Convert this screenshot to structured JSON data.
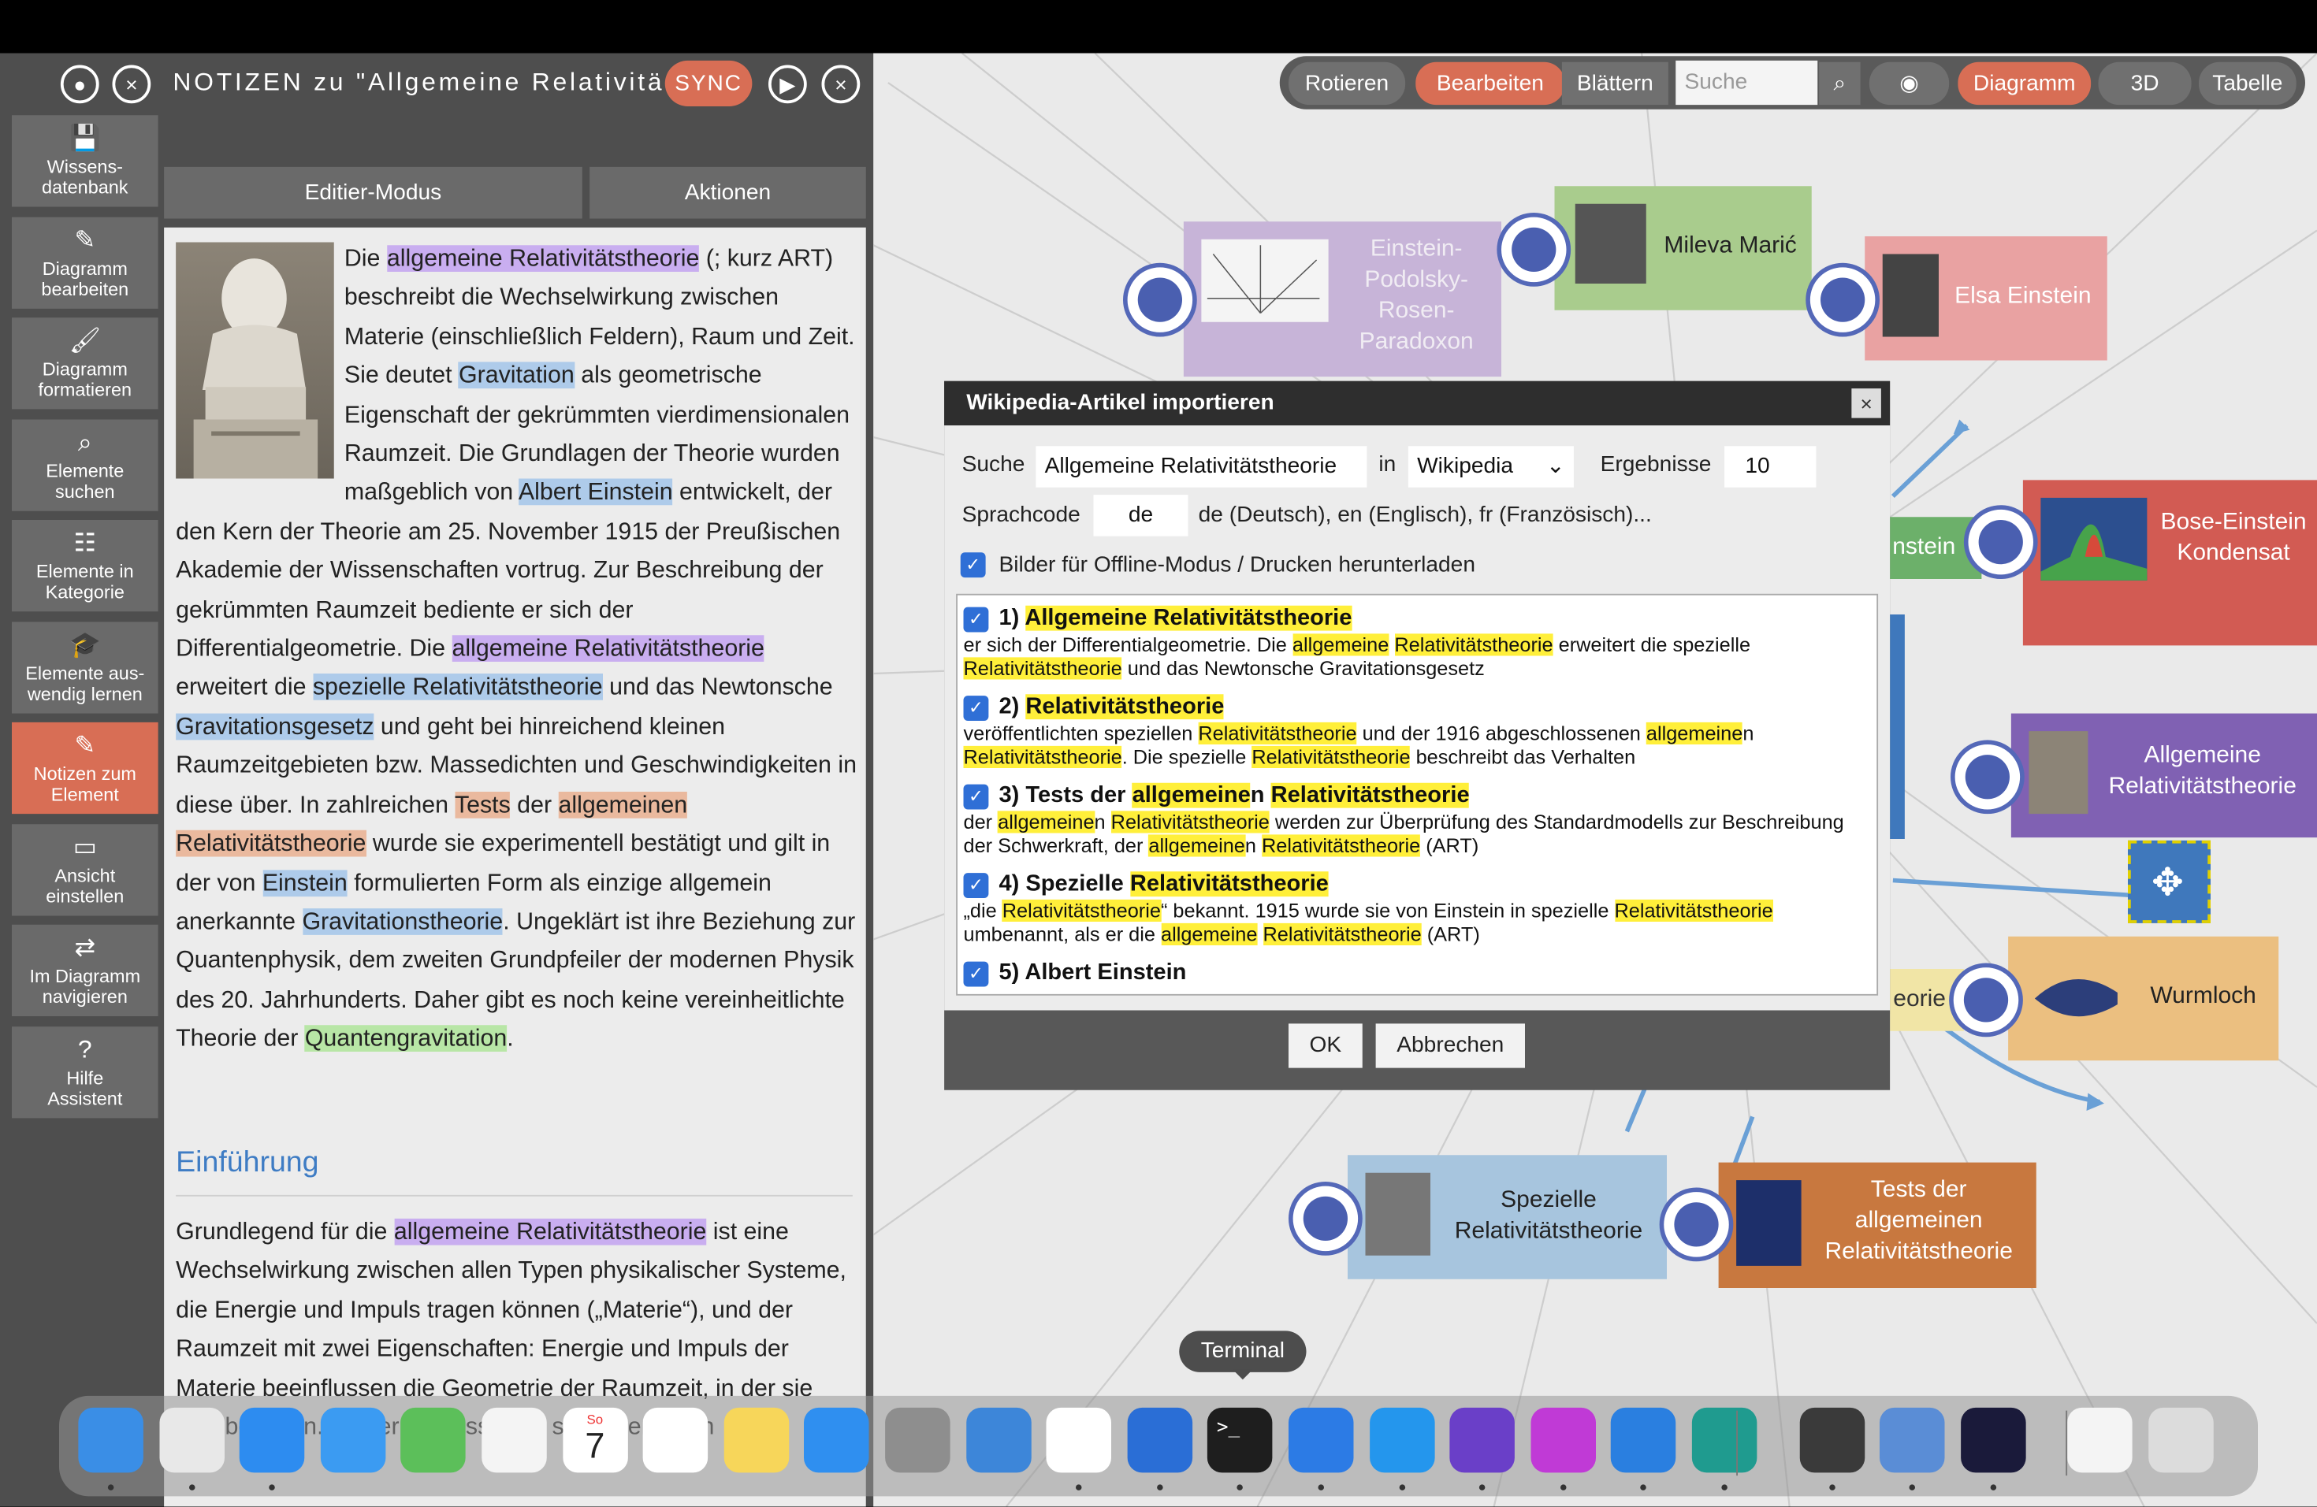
{
  "notes": {
    "title": "NOTIZEN zu \"Allgemeine Relativitä",
    "sync_label": "SYNC",
    "tabs": [
      "Editier-Modus",
      "Aktionen"
    ],
    "sidebar": [
      {
        "label": "Wissens-\ndatenbank",
        "icon": "save-icon"
      },
      {
        "label": "Diagramm\nbearbeiten",
        "icon": "pencil-icon"
      },
      {
        "label": "Diagramm\nformatieren",
        "icon": "brush-icon"
      },
      {
        "label": "Elemente\nsuchen",
        "icon": "search-icon"
      },
      {
        "label": "Elemente in\nKategorie",
        "icon": "category-icon"
      },
      {
        "label": "Elemente aus-\nwendig lernen",
        "icon": "graduation-icon"
      },
      {
        "label": "Notizen zum\nElement",
        "icon": "notes-icon"
      },
      {
        "label": "Ansicht\neinstellen",
        "icon": "monitor-icon"
      },
      {
        "label": "Im Diagramm\nnavigieren",
        "icon": "swap-icon"
      },
      {
        "label": "Hilfe\nAssistent",
        "icon": "help-icon"
      }
    ],
    "para1": [
      {
        "t": "Die "
      },
      {
        "t": "allgemeine Relativitätstheorie",
        "h": "p"
      },
      {
        "t": " (; kurz ART) beschreibt die Wechselwirkung zwischen Materie (einschließlich Feldern), Raum und Zeit. Sie deutet "
      },
      {
        "t": "Gravitation",
        "h": "b"
      },
      {
        "t": " als geometrische Eigenschaft der gekrümmten vierdimensionalen Raumzeit. Die Grundlagen der Theorie wurden maßgeblich von "
      },
      {
        "t": "Albert Einstein",
        "h": "b"
      },
      {
        "t": " entwickelt, der den Kern der Theorie am 25. November 1915 der Preußischen Akademie der Wissenschaften vortrug. Zur Beschreibung der gekrümmten Raumzeit bediente er sich der Differentialgeometrie. Die "
      },
      {
        "t": "allgemeine Relativitätstheorie",
        "h": "p"
      },
      {
        "t": " erweitert die "
      },
      {
        "t": "spezielle Relativitätstheorie",
        "h": "b"
      },
      {
        "t": " und das Newtonsche "
      },
      {
        "t": "Gravitationsgesetz",
        "h": "b"
      },
      {
        "t": " und geht bei hinreichend kleinen Raumzeitgebieten bzw. Massedichten und Geschwindigkeiten in diese über. In zahlreichen "
      },
      {
        "t": "Tests",
        "h": "o"
      },
      {
        "t": " der "
      },
      {
        "t": "allgemeinen Relativitätstheorie",
        "h": "o"
      },
      {
        "t": " wurde sie experimentell bestätigt und gilt in der von "
      },
      {
        "t": "Einstein",
        "h": "b"
      },
      {
        "t": " formulierten Form als einzige allgemein anerkannte "
      },
      {
        "t": "Gravitationstheorie",
        "h": "b"
      },
      {
        "t": ". Ungeklärt ist ihre Beziehung zur Quantenphysik, dem zweiten Grundpfeiler der modernen Physik des 20. Jahrhunderts. Daher gibt es noch keine vereinheitlichte Theorie der "
      },
      {
        "t": "Quantengravitation",
        "h": "g"
      },
      {
        "t": "."
      }
    ],
    "section_heading": "Einführung",
    "para2": [
      {
        "t": "Grundlegend für die "
      },
      {
        "t": "allgemeine Relativitätstheorie",
        "h": "p"
      },
      {
        "t": " ist eine Wechselwirkung zwischen allen Typen physikalischer Systeme, die Energie und Impuls tragen können („Materie“), und der Raumzeit mit zwei Eigenschaften: Energie und Impuls der Materie beeinflussen die Geometrie der Raumzeit, in der sie sich befinden. Dieser Einfluss lässt sich über einen"
      }
    ]
  },
  "toolbar": {
    "rotieren": "Rotieren",
    "bearbeiten": "Bearbeiten",
    "blaettern": "Blättern",
    "search_placeholder": "Suche",
    "diagramm": "Diagramm",
    "three_d": "3D",
    "tabelle": "Tabelle"
  },
  "nodes": {
    "epr": "Einstein-\nPodolsky-\nRosen-\nParadoxon",
    "mileva": "Mileva Marić",
    "elsa": "Elsa Einstein",
    "stein": "nstein",
    "bose": "Bose-Einstein\nKondensat",
    "art": "Allgemeine\nRelativitätstheorie",
    "eorie": "eorie",
    "wurmloch": "Wurmloch",
    "srt": "Spezielle\nRelativitätstheorie",
    "tests": "Tests der\nallgemeinen\nRelativitätstheorie"
  },
  "dialog": {
    "title": "Wikipedia-Artikel importieren",
    "close": "×",
    "suche_label": "Suche",
    "suche_value": "Allgemeine Relativitätstheorie",
    "in_label": "in",
    "source_value": "Wikipedia",
    "ergebnisse_label": "Ergebnisse",
    "ergebnisse_value": "10",
    "sprachcode_label": "Sprachcode",
    "sprachcode_value": "de",
    "sprachcode_hint": "de (Deutsch), en (Englisch), fr (Französisch)...",
    "offline_label": "Bilder für Offline-Modus / Drucken herunterladen",
    "results": [
      {
        "title": [
          {
            "t": "1) "
          },
          {
            "t": "Allgemeine Relativitätstheorie",
            "y": true
          }
        ],
        "snippet": [
          {
            "t": "er sich der Differentialgeometrie. Die "
          },
          {
            "t": "allgemeine",
            "y": true
          },
          {
            "t": " "
          },
          {
            "t": "Relativitätstheorie",
            "y": true
          },
          {
            "t": " erweitert die spezielle "
          },
          {
            "t": "Relativitätstheorie",
            "y": true
          },
          {
            "t": " und das Newtonsche Gravitationsgesetz"
          }
        ]
      },
      {
        "title": [
          {
            "t": "2) "
          },
          {
            "t": "Relativitätstheorie",
            "y": true
          }
        ],
        "snippet": [
          {
            "t": "veröffentlichten speziellen "
          },
          {
            "t": "Relativitätstheorie",
            "y": true
          },
          {
            "t": " und der 1916 abgeschlossenen "
          },
          {
            "t": "allgemeine",
            "y": true
          },
          {
            "t": "n "
          },
          {
            "t": "Relativitätstheorie",
            "y": true
          },
          {
            "t": ". Die spezielle "
          },
          {
            "t": "Relativitätstheorie",
            "y": true
          },
          {
            "t": " beschreibt das Verhalten"
          }
        ]
      },
      {
        "title": [
          {
            "t": "3) Tests der "
          },
          {
            "t": "allgemeine",
            "y": true
          },
          {
            "t": "n "
          },
          {
            "t": "Relativitätstheorie",
            "y": true
          }
        ],
        "snippet": [
          {
            "t": "der "
          },
          {
            "t": "allgemeine",
            "y": true
          },
          {
            "t": "n "
          },
          {
            "t": "Relativitätstheorie",
            "y": true
          },
          {
            "t": " werden zur Überprüfung des Standardmodells zur Beschreibung der Schwerkraft, der "
          },
          {
            "t": "allgemeine",
            "y": true
          },
          {
            "t": "n "
          },
          {
            "t": "Relativitätstheorie",
            "y": true
          },
          {
            "t": " (ART)"
          }
        ]
      },
      {
        "title": [
          {
            "t": "4) Spezielle "
          },
          {
            "t": "Relativitätstheorie",
            "y": true
          }
        ],
        "snippet": [
          {
            "t": "„die "
          },
          {
            "t": "Relativitätstheorie",
            "y": true
          },
          {
            "t": "“ bekannt. 1915 wurde sie von Einstein in spezielle "
          },
          {
            "t": "Relativitätstheorie",
            "y": true
          },
          {
            "t": " umbenannt, als er die "
          },
          {
            "t": "allgemeine",
            "y": true
          },
          {
            "t": " "
          },
          {
            "t": "Relativitätstheorie",
            "y": true
          },
          {
            "t": " (ART)"
          }
        ]
      },
      {
        "title": [
          {
            "t": "5) Albert Einstein"
          }
        ],
        "snippet": []
      }
    ],
    "ok": "OK",
    "cancel": "Abbrechen"
  },
  "dock": {
    "tooltip": "Terminal",
    "calendar_month": "So",
    "calendar_day": "7",
    "apps": [
      "finder-icon",
      "launchpad-icon",
      "safari-icon",
      "mail-icon",
      "maps-icon",
      "photos-icon",
      "calendar-icon",
      "reminders-icon",
      "notes-icon",
      "appstore-icon",
      "settings-icon",
      "weather-icon",
      "vscode-icon",
      "xcode-icon",
      "terminal-icon",
      "snowflake-icon",
      "docker-icon",
      "imovie-icon",
      "shortcuts-icon",
      "quicktime-icon",
      "edge-icon",
      "accessibility-icon",
      "disk-icon",
      "arc-icon",
      "document-icon",
      "trash-icon"
    ]
  },
  "colors": {
    "accent": "#d86e55",
    "panel": "#4e4e4e",
    "node_purple": "#8061b3",
    "node_blue": "#3f78bc",
    "node_orange": "#c8783f",
    "node_red": "#c94d45"
  }
}
